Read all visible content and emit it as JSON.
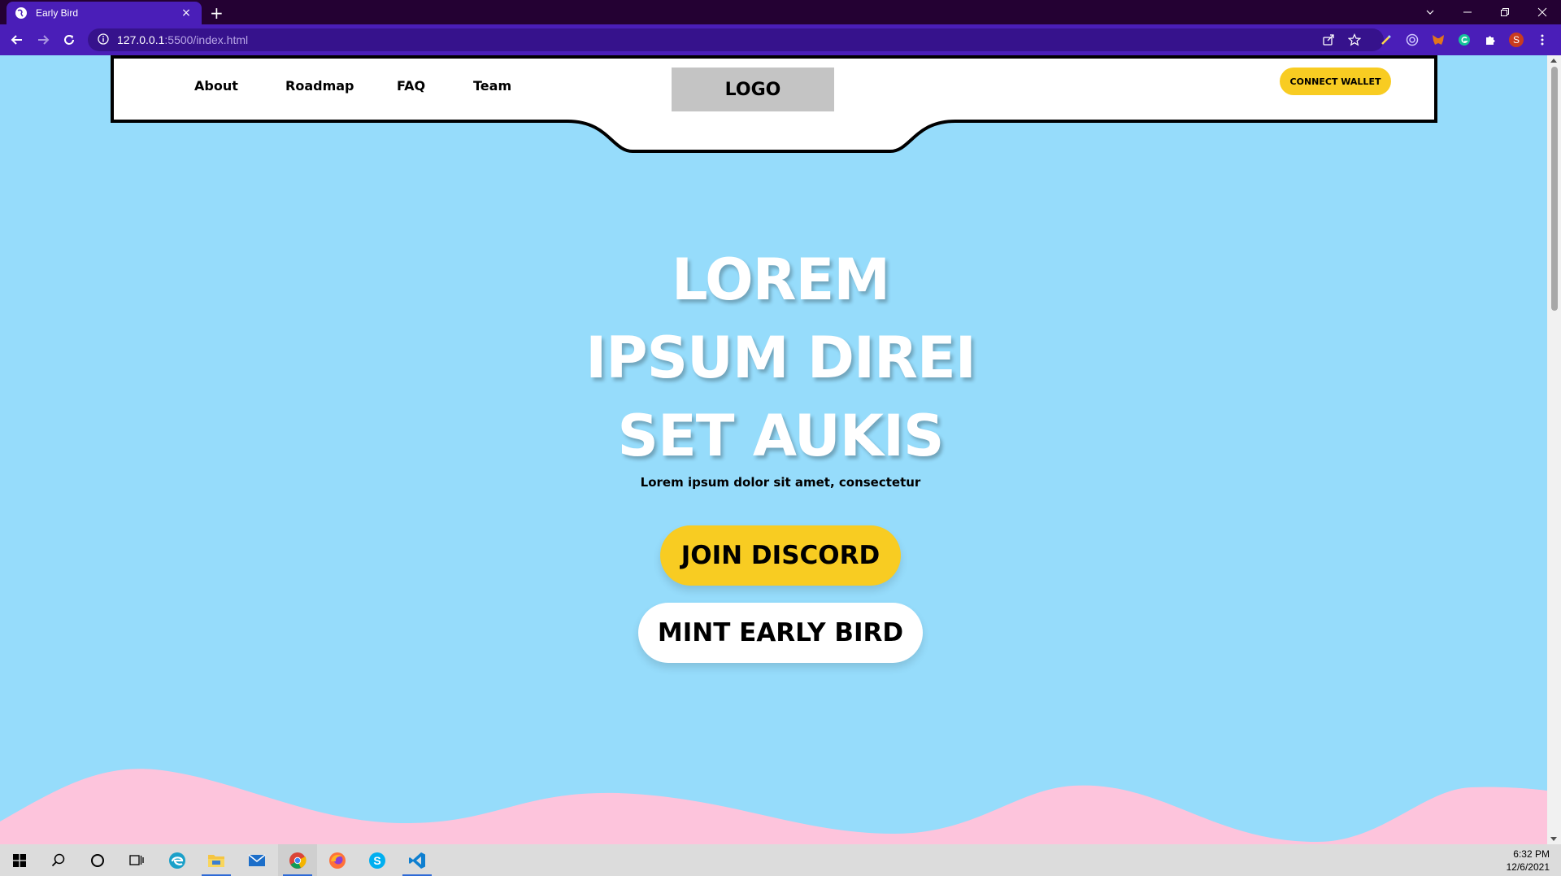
{
  "browser": {
    "tab_title": "Early Bird",
    "tab_close": "×",
    "new_tab": "+",
    "url_host": "127.0.0.1",
    "url_path": ":5500/index.html",
    "window_controls": [
      "chevron-down",
      "minimize",
      "restore",
      "close"
    ],
    "profile_initial": "S"
  },
  "nav": {
    "links": [
      "About",
      "Roadmap",
      "FAQ",
      "Team"
    ],
    "logo": "LOGO",
    "connect_wallet": "CONNECT WALLET"
  },
  "hero": {
    "title_line1": "LOREM",
    "title_line2": "IPSUM DIREI",
    "title_line3": "SET AUKIS",
    "subtitle": "Lorem ipsum dolor sit amet, consectetur",
    "join_discord": "JOIN DISCORD",
    "mint_early_bird": "MINT EARLY BIRD"
  },
  "taskbar": {
    "time": "6:32 PM",
    "date": "12/6/2021",
    "apps": [
      "start",
      "search",
      "cortana",
      "task-view",
      "edge",
      "file-explorer",
      "mail",
      "chrome",
      "firefox",
      "skype",
      "vscode"
    ]
  },
  "colors": {
    "sky": "#96dcfb",
    "accent_yellow": "#f8cc22",
    "wave_pink": "#fdc4dc",
    "chrome_purple": "#4a1eb8",
    "titlebar": "#240133"
  }
}
